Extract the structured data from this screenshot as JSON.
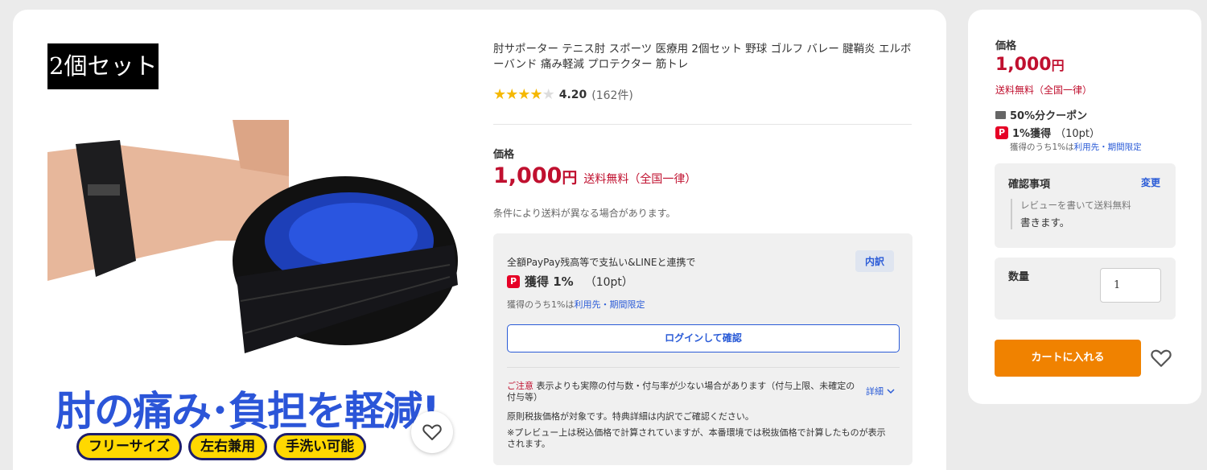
{
  "product": {
    "image_badge": "2個セット",
    "image_banner": "肘の痛み･負担を軽減!",
    "image_pills": [
      "フリーサイズ",
      "左右兼用",
      "手洗い可能"
    ],
    "title": "肘サポーター テニス肘 スポーツ 医療用 2個セット 野球 ゴルフ バレー 腱鞘炎 エルボーバンド 痛み軽減 プロテクター 筋トレ",
    "rating": {
      "stars": 4.2,
      "value": "4.20",
      "count": "(162件)"
    }
  },
  "price": {
    "label": "価格",
    "amount": "1,000",
    "yen": "円",
    "shipping": "送料無料（全国一律）",
    "note": "条件により送料が異なる場合があります。"
  },
  "paypay": {
    "description": "全額PayPay残高等で支払い&LINEと連携で",
    "tag": "内訳",
    "icon": "P",
    "earn": "獲得 1%",
    "points": "（10pt）",
    "sub_prefix": "獲得のうち1%は",
    "sub_link": "利用先・期間限定",
    "login_button": "ログインして確認",
    "caution_label": "ご注意",
    "caution_text": " 表示よりも実際の付与数・付与率が少ない場合があります（付与上限、未確定の付与等）",
    "detail_link": "詳細",
    "note1": "原則税抜価格が対象です。特典詳細は内訳でご確認ください。",
    "note2": "※プレビュー上は税込価格で計算されていますが、本番環境では税抜価格で計算したものが表示されます。"
  },
  "side": {
    "price_label": "価格",
    "price_amount": "1,000",
    "price_yen": "円",
    "shipping": "送料無料（全国一律）",
    "coupon": "50%分クーポン",
    "earn_icon": "P",
    "earn": "1%獲得",
    "earn_pt": "（10pt）",
    "earn_sub_prefix": "獲得のうち1%は",
    "earn_sub_link": "利用先・期間限定",
    "confirm_title": "確認事項",
    "confirm_change": "変更",
    "confirm_hint": "レビューを書いて送料無料",
    "confirm_value": "書きます。",
    "qty_label": "数量",
    "qty_value": "1",
    "cart_button": "カートに入れる"
  },
  "colors": {
    "price_red": "#c0102f",
    "link_blue": "#2a5bd7",
    "cart_orange": "#f08200",
    "star_gold": "#f5b800"
  }
}
